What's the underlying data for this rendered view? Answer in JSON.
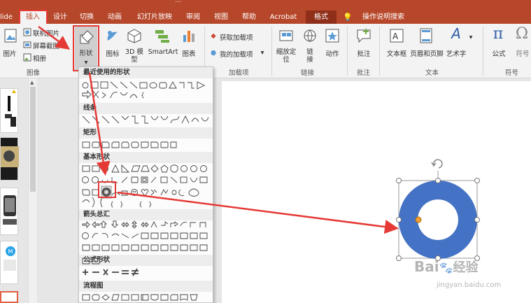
{
  "title_fragment": "...",
  "tabs": [
    {
      "label": "lide"
    },
    {
      "label": "插入"
    },
    {
      "label": "设计"
    },
    {
      "label": "切换"
    },
    {
      "label": "动画"
    },
    {
      "label": "幻灯片放映"
    },
    {
      "label": "审阅"
    },
    {
      "label": "视图"
    },
    {
      "label": "帮助"
    },
    {
      "label": "Acrobat"
    },
    {
      "label": "格式"
    },
    {
      "label": "操作说明搜索"
    }
  ],
  "ribbon": {
    "picture": "图片",
    "online_picture": "联机图片",
    "screenshot": "屏幕截图",
    "album": "相册",
    "shapes": "形状",
    "icons": "图标",
    "model3d": "3D 模型",
    "smartart": "SmartArt",
    "chart": "图表",
    "get_addins": "获取加载项",
    "my_addins": "我的加载项",
    "zoom": "缩放定位",
    "link": "链接",
    "action": "动作",
    "comment": "批注",
    "textbox": "文本框",
    "header_footer": "页眉和页脚",
    "wordart": "艺术字",
    "formula": "公式",
    "symbol": "符号",
    "groups": {
      "images": "图像",
      "addins": "加载项",
      "links": "链接",
      "comments": "批注",
      "text": "文本",
      "symbols": "符号"
    }
  },
  "gallery": {
    "categories": [
      "最近使用的形状",
      "线条",
      "矩形",
      "基本形状",
      "箭头总汇",
      "公式形状",
      "流程图"
    ]
  },
  "watermark": {
    "brand": "Bai",
    "brand2": "经验",
    "url": "jingyan.baidu.com"
  },
  "colors": {
    "accent": "#b7472a",
    "donut": "#4472c4",
    "highlight": "#e53935"
  }
}
